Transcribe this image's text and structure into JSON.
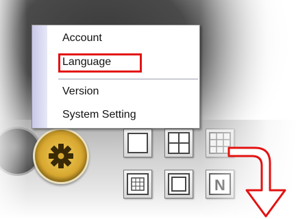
{
  "menu": {
    "items": [
      {
        "label": "Account"
      },
      {
        "label": "Language",
        "highlighted": true
      },
      {
        "label": "Version"
      },
      {
        "label": "System Setting"
      }
    ]
  },
  "buttons": {
    "settings_icon": "gear-icon",
    "layout_icons": [
      "single-view-icon",
      "quad-view-icon",
      "nine-view-icon",
      "sixteen-view-icon",
      "multi-view-icon",
      "n-view-icon"
    ],
    "n_view_label": "N"
  },
  "annotation": {
    "highlight_color": "#e31212",
    "arrow_color": "#e31212"
  }
}
